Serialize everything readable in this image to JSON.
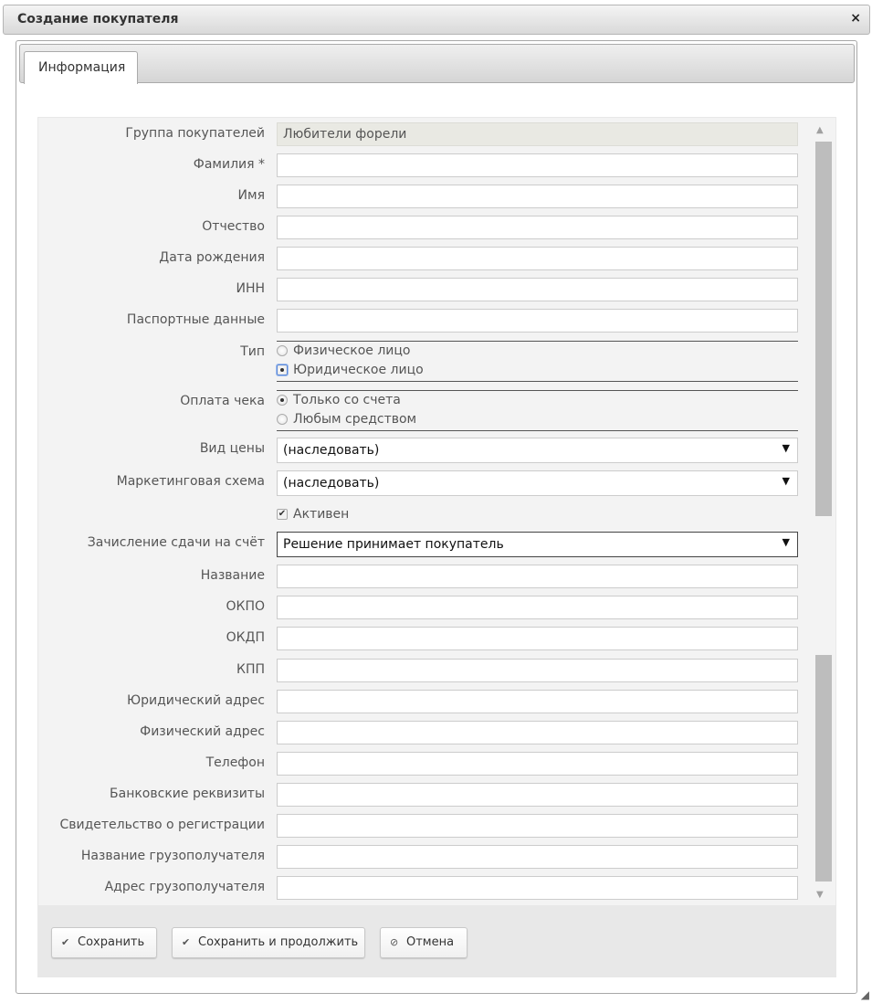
{
  "window": {
    "title": "Создание покупателя",
    "close_icon": "×"
  },
  "tabs": [
    {
      "label": "Информация"
    }
  ],
  "form": {
    "group": {
      "label": "Группа покупателей",
      "value": "Любители форели"
    },
    "last_name": {
      "label": "Фамилия *",
      "value": ""
    },
    "first_name": {
      "label": "Имя",
      "value": ""
    },
    "patronymic": {
      "label": "Отчество",
      "value": ""
    },
    "birth_date": {
      "label": "Дата рождения",
      "value": ""
    },
    "inn": {
      "label": "ИНН",
      "value": ""
    },
    "passport": {
      "label": "Паспортные данные",
      "value": ""
    },
    "type": {
      "label": "Тип",
      "options": [
        "Физическое лицо",
        "Юридическое лицо"
      ],
      "selected": "Юридическое лицо"
    },
    "payment": {
      "label": "Оплата чека",
      "options": [
        "Только со счета",
        "Любым средством"
      ],
      "selected": "Только со счета"
    },
    "price_type": {
      "label": "Вид цены",
      "value": "(наследовать)"
    },
    "marketing": {
      "label": "Маркетинговая схема",
      "value": "(наследовать)"
    },
    "active": {
      "label": "Активен",
      "checked": true
    },
    "change": {
      "label": "Зачисление сдачи на счёт",
      "value": "Решение принимает покупатель"
    },
    "company_name": {
      "label": "Название",
      "value": ""
    },
    "okpo": {
      "label": "ОКПО",
      "value": ""
    },
    "okdp": {
      "label": "ОКДП",
      "value": ""
    },
    "kpp": {
      "label": "КПП",
      "value": ""
    },
    "legal_address": {
      "label": "Юридический адрес",
      "value": ""
    },
    "physical_address": {
      "label": "Физический адрес",
      "value": ""
    },
    "phone": {
      "label": "Телефон",
      "value": ""
    },
    "bank_details": {
      "label": "Банковские реквизиты",
      "value": ""
    },
    "registration": {
      "label": "Свидетельство о регистрации",
      "value": ""
    },
    "consignee_name": {
      "label": "Название грузополучателя",
      "value": ""
    },
    "consignee_address": {
      "label": "Адрес грузополучателя",
      "value": ""
    }
  },
  "buttons": {
    "save": {
      "label": "Сохранить",
      "icon": "check-icon"
    },
    "save_continue": {
      "label": "Сохранить и продолжить",
      "icon": "check-icon"
    },
    "cancel": {
      "label": "Отмена",
      "icon": "cancel-icon"
    }
  },
  "colors": {
    "titlebar": "#e4e4e4",
    "form_bg": "#f3f3f3",
    "readonly_field": "#e9e9e3",
    "focus_ring": "#5b88d6"
  }
}
